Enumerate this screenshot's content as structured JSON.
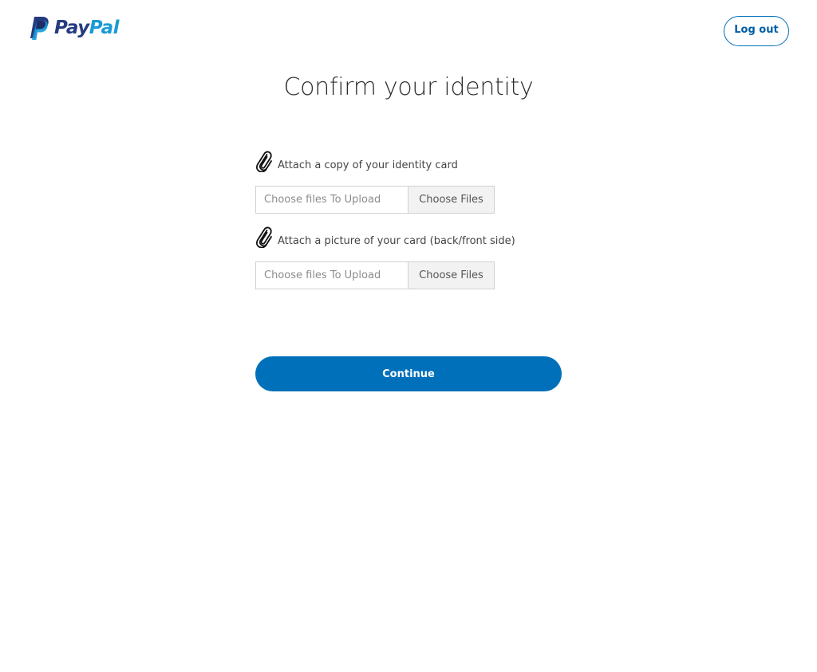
{
  "header": {
    "logo_text_pay": "Pay",
    "logo_text_pal": "Pal",
    "logout_label": "Log out"
  },
  "title": "Confirm your identity",
  "uploads": [
    {
      "label": "Attach a copy of your identity card",
      "placeholder": "Choose files To Upload",
      "button_label": "Choose Files",
      "icon": "paperclip-icon"
    },
    {
      "label": "Attach a picture of your card (back/front side)",
      "placeholder": "Choose files To Upload",
      "button_label": "Choose Files",
      "icon": "paperclip-icon"
    }
  ],
  "continue_label": "Continue",
  "colors": {
    "brand_dark": "#253b80",
    "brand_light": "#179bd7",
    "button_blue": "#0070ba"
  }
}
